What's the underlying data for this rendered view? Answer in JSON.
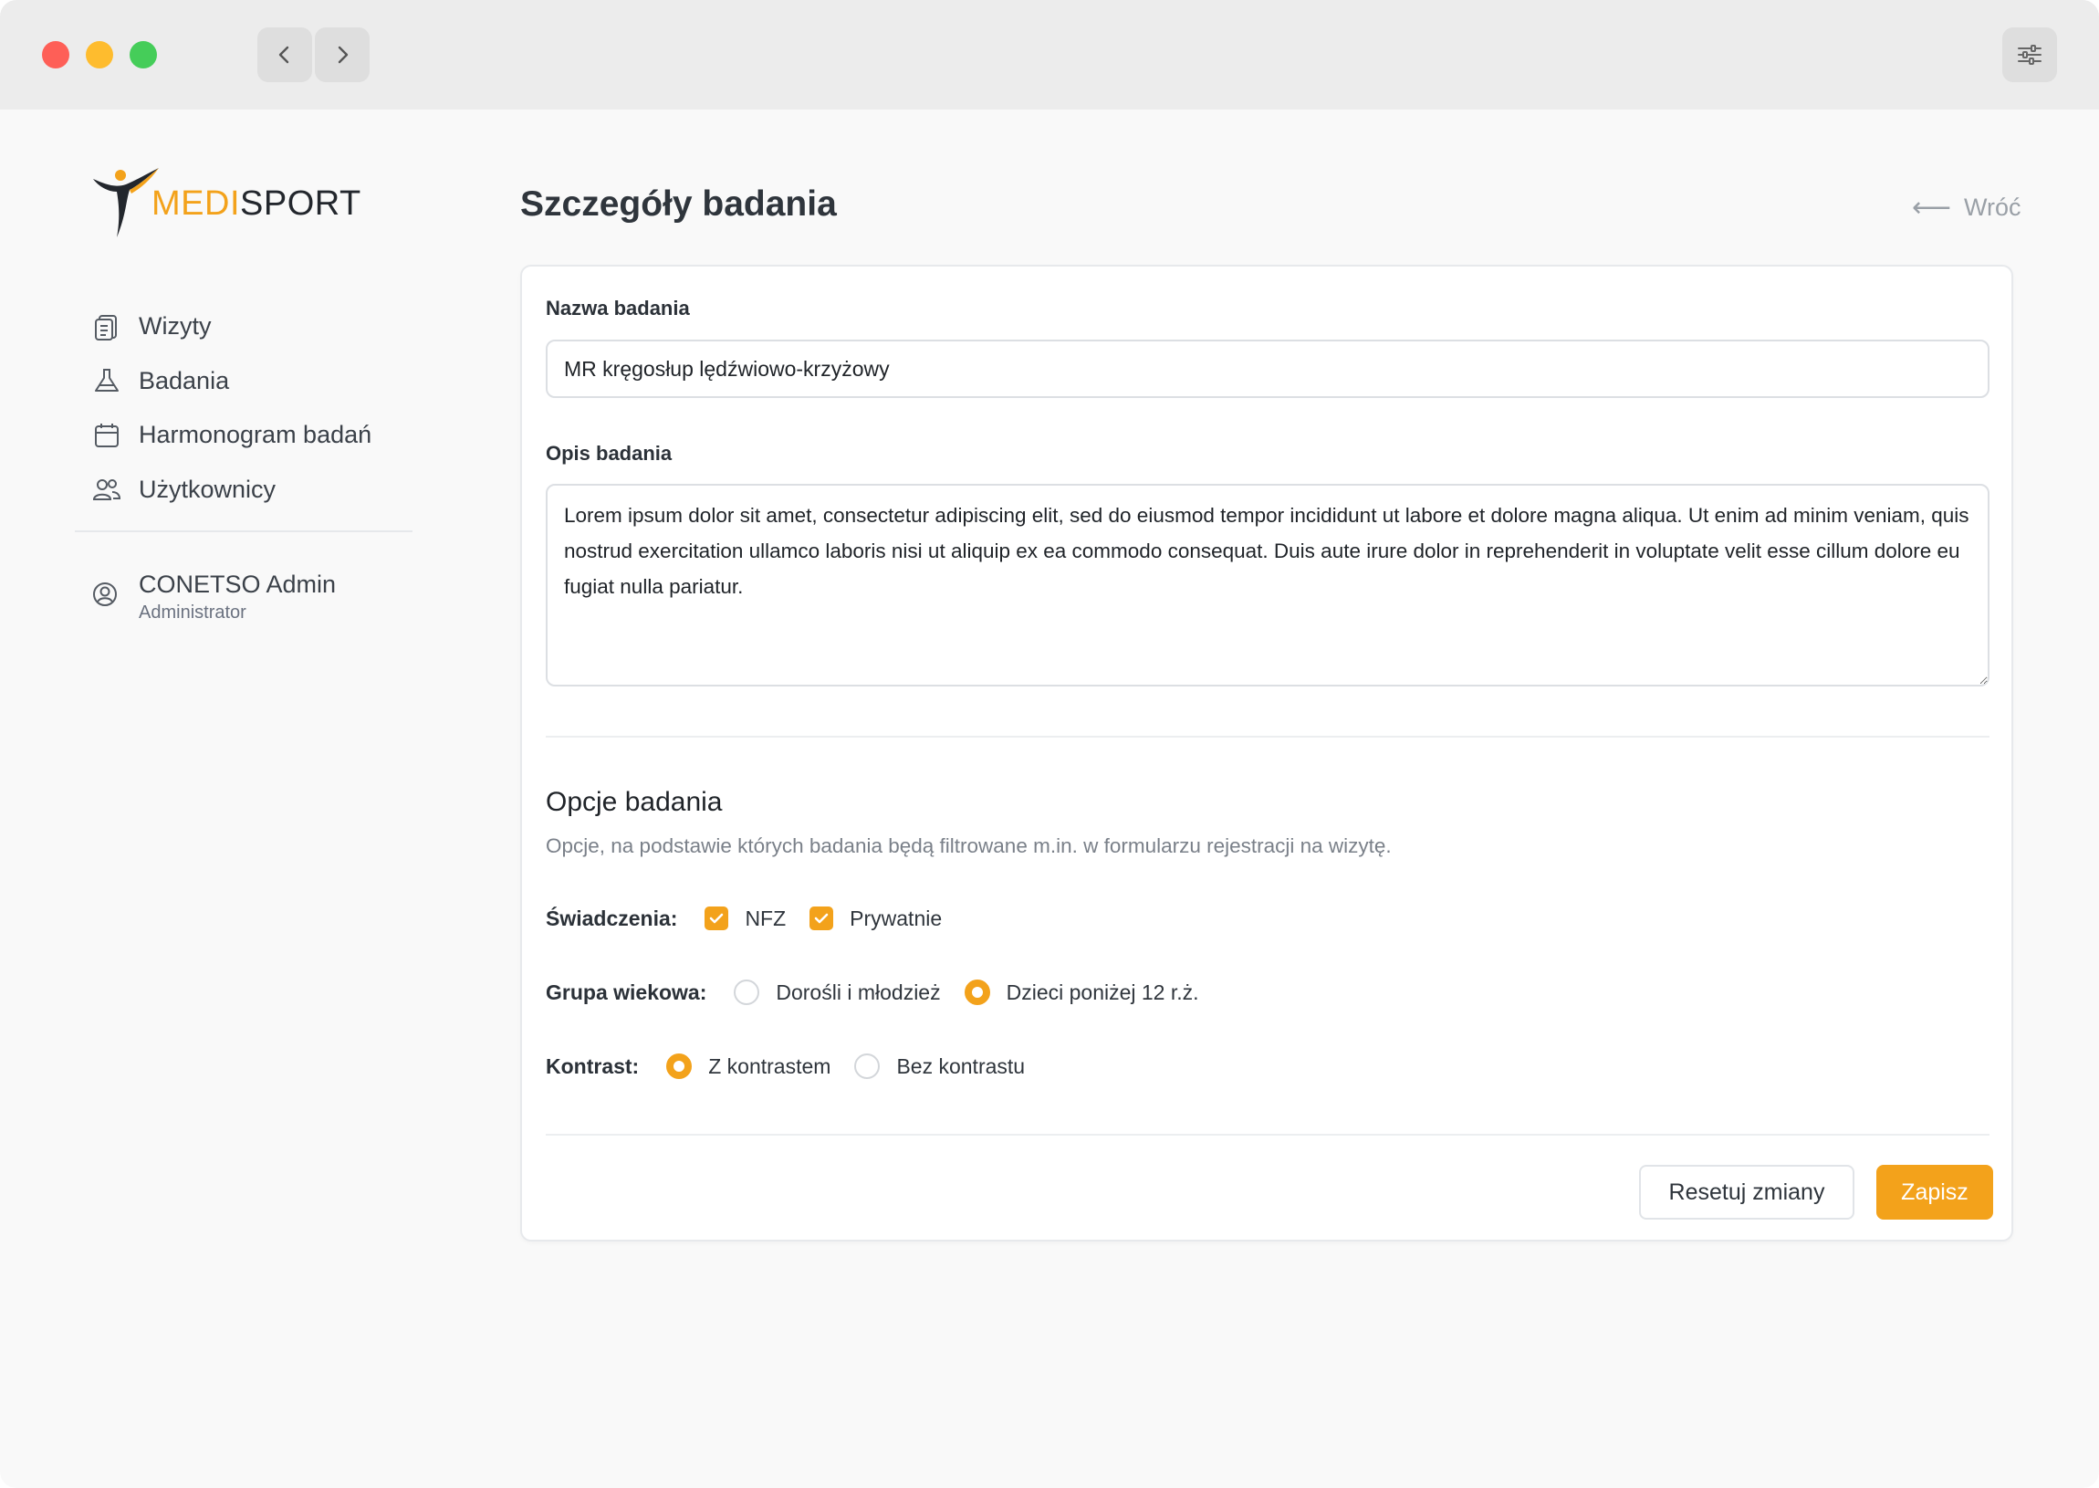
{
  "brand": {
    "part1": "MEDI",
    "part2": "SPORT",
    "accent": "#f3a21b"
  },
  "sidebar": {
    "items": [
      {
        "label": "Wizyty",
        "icon": "clipboard-icon"
      },
      {
        "label": "Badania",
        "icon": "flask-icon"
      },
      {
        "label": "Harmonogram badań",
        "icon": "calendar-icon"
      },
      {
        "label": "Użytkownicy",
        "icon": "users-icon"
      }
    ],
    "user": {
      "name": "CONETSO Admin",
      "role": "Administrator",
      "icon": "user-circle-icon"
    }
  },
  "header": {
    "title": "Szczegóły badania",
    "back_label": "Wróć"
  },
  "form": {
    "name_label": "Nazwa badania",
    "name_value": "MR kręgosłup lędźwiowo-krzyżowy",
    "desc_label": "Opis badania",
    "desc_value": "Lorem ipsum dolor sit amet, consectetur adipiscing elit, sed do eiusmod tempor incididunt ut labore et dolore magna aliqua. Ut enim ad minim veniam, quis nostrud exercitation ullamco laboris nisi ut aliquip ex ea commodo consequat. Duis aute irure dolor in reprehenderit in voluptate velit esse cillum dolore eu fugiat nulla pariatur."
  },
  "options": {
    "title": "Opcje badania",
    "description": "Opcje, na podstawie których badania będą filtrowane m.in. w formularzu rejestracji na wizytę.",
    "benefits": {
      "label": "Świadczenia:",
      "opt1": "NFZ",
      "opt1_checked": true,
      "opt2": "Prywatnie",
      "opt2_checked": true
    },
    "age_group": {
      "label": "Grupa wiekowa:",
      "opt1": "Dorośli i młodzież",
      "opt2": "Dzieci poniżej 12 r.ż.",
      "selected": "Dzieci poniżej 12 r.ż."
    },
    "contrast": {
      "label": "Kontrast:",
      "opt1": "Z kontrastem",
      "opt2": "Bez kontrastu",
      "selected": "Z kontrastem"
    }
  },
  "actions": {
    "reset_label": "Resetuj zmiany",
    "save_label": "Zapisz"
  }
}
